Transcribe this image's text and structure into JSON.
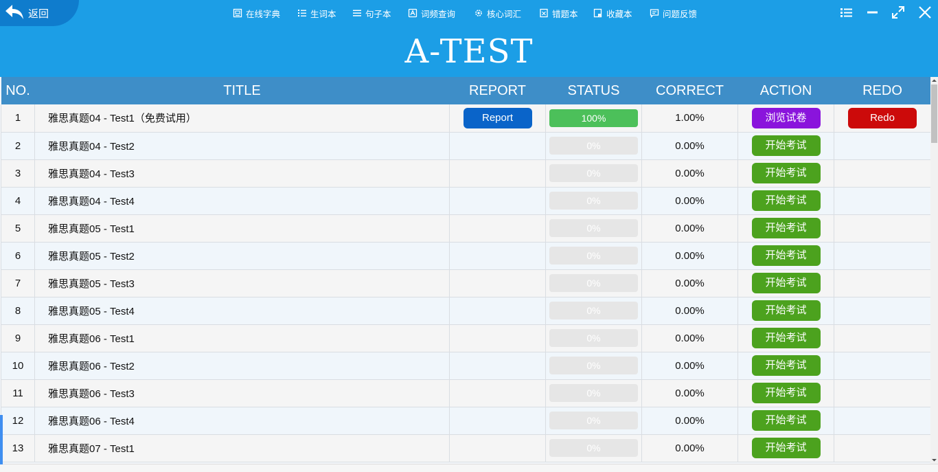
{
  "topbar": {
    "back_label": "返回",
    "menu": [
      {
        "label": "在线字典",
        "icon": "dictionary-icon"
      },
      {
        "label": "生词本",
        "icon": "list-icon"
      },
      {
        "label": "句子本",
        "icon": "lines-icon"
      },
      {
        "label": "词频查询",
        "icon": "word-frequency-icon"
      },
      {
        "label": "核心词汇",
        "icon": "gear-icon"
      },
      {
        "label": "错题本",
        "icon": "mistake-book-icon"
      },
      {
        "label": "收藏本",
        "icon": "bookmark-book-icon"
      },
      {
        "label": "问题反馈",
        "icon": "feedback-icon"
      }
    ]
  },
  "app_title": "A-TEST",
  "table": {
    "headers": [
      "NO.",
      "TITLE",
      "REPORT",
      "STATUS",
      "CORRECT",
      "ACTION",
      "REDO"
    ],
    "rows": [
      {
        "no": "1",
        "title": "雅思真题04 - Test1（免费试用）",
        "report": "Report",
        "status": "100%",
        "progress": 1.0,
        "correct": "1.00%",
        "action": "浏览试卷",
        "action_type": "review",
        "redo": "Redo"
      },
      {
        "no": "2",
        "title": "雅思真题04 - Test2",
        "report": "",
        "status": "0%",
        "progress": 0,
        "correct": "0.00%",
        "action": "开始考试",
        "action_type": "start",
        "redo": ""
      },
      {
        "no": "3",
        "title": "雅思真题04 - Test3",
        "report": "",
        "status": "0%",
        "progress": 0,
        "correct": "0.00%",
        "action": "开始考试",
        "action_type": "start",
        "redo": ""
      },
      {
        "no": "4",
        "title": "雅思真题04 - Test4",
        "report": "",
        "status": "0%",
        "progress": 0,
        "correct": "0.00%",
        "action": "开始考试",
        "action_type": "start",
        "redo": ""
      },
      {
        "no": "5",
        "title": "雅思真题05 - Test1",
        "report": "",
        "status": "0%",
        "progress": 0,
        "correct": "0.00%",
        "action": "开始考试",
        "action_type": "start",
        "redo": ""
      },
      {
        "no": "6",
        "title": "雅思真题05 - Test2",
        "report": "",
        "status": "0%",
        "progress": 0,
        "correct": "0.00%",
        "action": "开始考试",
        "action_type": "start",
        "redo": ""
      },
      {
        "no": "7",
        "title": "雅思真题05 - Test3",
        "report": "",
        "status": "0%",
        "progress": 0,
        "correct": "0.00%",
        "action": "开始考试",
        "action_type": "start",
        "redo": ""
      },
      {
        "no": "8",
        "title": "雅思真题05 - Test4",
        "report": "",
        "status": "0%",
        "progress": 0,
        "correct": "0.00%",
        "action": "开始考试",
        "action_type": "start",
        "redo": ""
      },
      {
        "no": "9",
        "title": "雅思真题06 - Test1",
        "report": "",
        "status": "0%",
        "progress": 0,
        "correct": "0.00%",
        "action": "开始考试",
        "action_type": "start",
        "redo": ""
      },
      {
        "no": "10",
        "title": "雅思真题06 - Test2",
        "report": "",
        "status": "0%",
        "progress": 0,
        "correct": "0.00%",
        "action": "开始考试",
        "action_type": "start",
        "redo": ""
      },
      {
        "no": "11",
        "title": "雅思真题06 - Test3",
        "report": "",
        "status": "0%",
        "progress": 0,
        "correct": "0.00%",
        "action": "开始考试",
        "action_type": "start",
        "redo": ""
      },
      {
        "no": "12",
        "title": "雅思真题06 - Test4",
        "report": "",
        "status": "0%",
        "progress": 0,
        "correct": "0.00%",
        "action": "开始考试",
        "action_type": "start",
        "redo": ""
      },
      {
        "no": "13",
        "title": "雅思真题07 - Test1",
        "report": "",
        "status": "0%",
        "progress": 0,
        "correct": "0.00%",
        "action": "开始考试",
        "action_type": "start",
        "redo": ""
      }
    ]
  },
  "colors": {
    "header_bg": "#1c9ee6",
    "table_header_bg": "#3e8ec8",
    "report_button": "#0a64c9",
    "review_button": "#8a14dc",
    "start_button": "#4ca21e",
    "redo_button": "#cc0a0a",
    "progress_fill": "#4cc05a"
  }
}
